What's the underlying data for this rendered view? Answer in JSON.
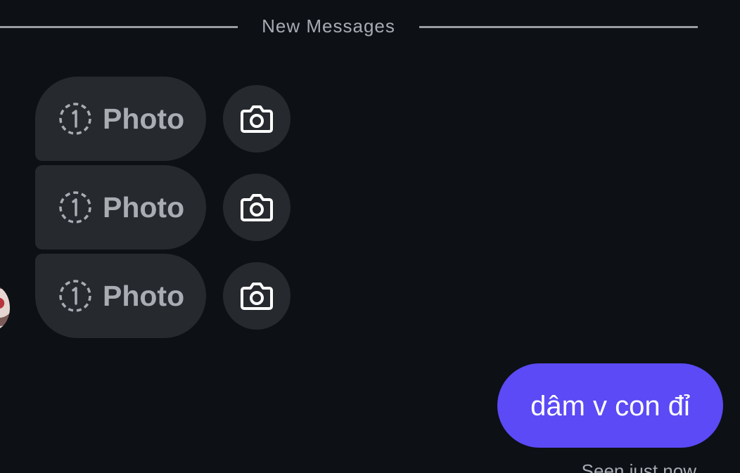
{
  "divider": {
    "label": "New Messages"
  },
  "received_messages": [
    {
      "label": "Photo",
      "timer_icon": "view-once-1-icon",
      "action_icon": "camera-icon"
    },
    {
      "label": "Photo",
      "timer_icon": "view-once-1-icon",
      "action_icon": "camera-icon"
    },
    {
      "label": "Photo",
      "timer_icon": "view-once-1-icon",
      "action_icon": "camera-icon"
    }
  ],
  "sent_message": {
    "text": "dâm v con đỉ"
  },
  "status": {
    "seen": "Seen just now"
  },
  "colors": {
    "background": "#0d1015",
    "received_bubble": "#26292e",
    "sent_bubble": "#5b4af5",
    "muted_text": "#a8abb2"
  }
}
